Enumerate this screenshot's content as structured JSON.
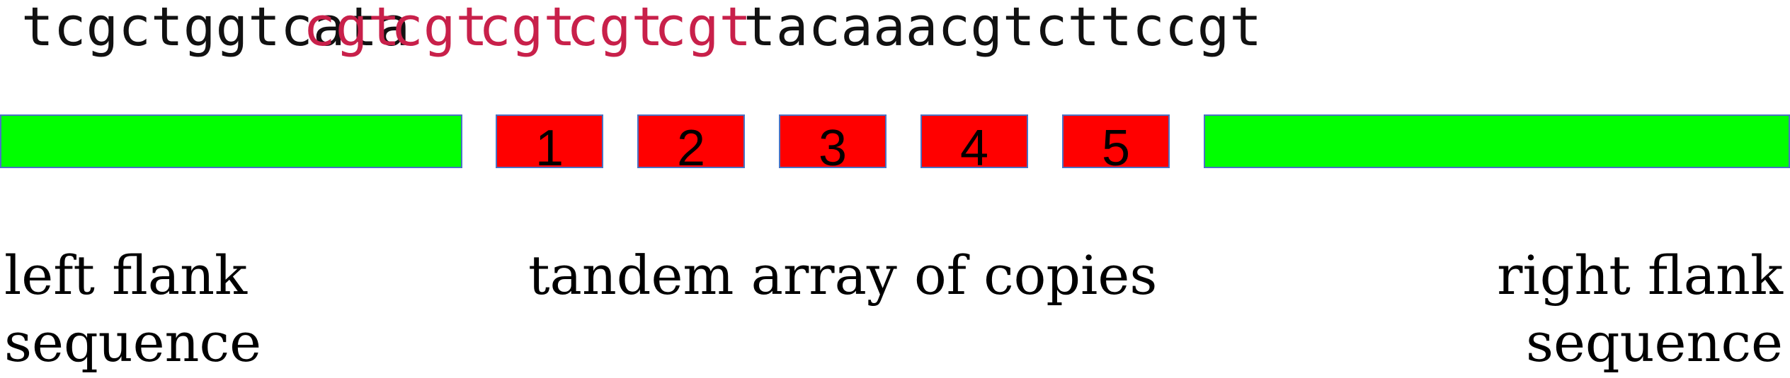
{
  "sequence": {
    "left_flank": "tcgctggtcata",
    "copies": [
      "cgt",
      "cgt",
      "cgt",
      "cgt",
      "cgt"
    ],
    "right_flank": "tacaaacgtcttccgt"
  },
  "diagram": {
    "copy_numbers": [
      "1",
      "2",
      "3",
      "4",
      "5"
    ]
  },
  "labels": {
    "left_flank_line1": "left flank",
    "left_flank_line2": "sequence",
    "tandem_array": "tandem array of copies",
    "right_flank_line1": "right flank",
    "right_flank_line2": "sequence"
  },
  "colors": {
    "flank": "#00ff00",
    "copy": "#ff0000",
    "repeat_text": "#c8204a",
    "box_border": "#4a72c4"
  }
}
